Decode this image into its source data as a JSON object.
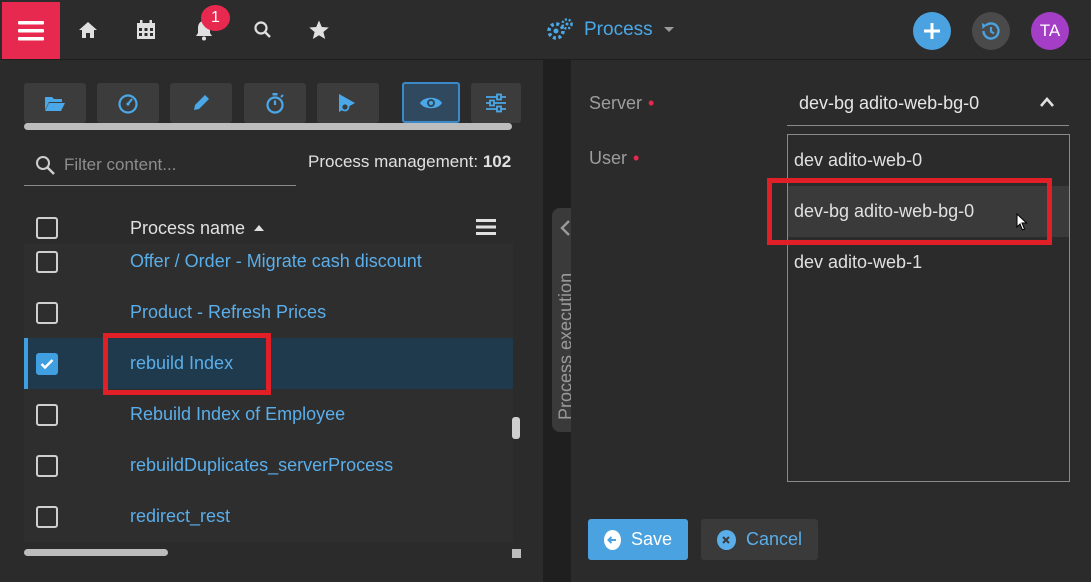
{
  "topbar": {
    "notification_count": "1",
    "module_title": "Process",
    "avatar_initials": "TA",
    "icons": [
      "menu-icon",
      "home-icon",
      "calendar-icon",
      "bell-icon",
      "search-icon",
      "star-icon",
      "gears-icon",
      "plus-icon",
      "history-icon"
    ]
  },
  "left": {
    "toolbar_icons": [
      "folder-open-icon",
      "speedometer-icon",
      "pencil-icon",
      "stopwatch-icon",
      "play-gear-icon",
      "eye-icon",
      "sliders-icon"
    ],
    "filter_placeholder": "Filter content...",
    "count_label": "Process management:",
    "count_value": "102",
    "column_header": "Process name",
    "rows": [
      {
        "name": "Offer / Order - Migrate cash discount",
        "checked": false
      },
      {
        "name": "Product - Refresh Prices",
        "checked": false
      },
      {
        "name": "rebuild Index",
        "checked": true
      },
      {
        "name": "Rebuild Index of Employee",
        "checked": false
      },
      {
        "name": "rebuildDuplicates_serverProcess",
        "checked": false
      },
      {
        "name": "redirect_rest",
        "checked": false
      }
    ]
  },
  "splitter": {
    "label": "Process execution"
  },
  "right": {
    "server_label": "Server",
    "server_value": "dev-bg adito-web-bg-0",
    "user_label": "User",
    "required_mark": "•",
    "options": [
      "dev adito-web-0",
      "dev-bg adito-web-bg-0",
      "dev adito-web-1"
    ],
    "hovered_option": "dev-bg adito-web-bg-0",
    "save_label": "Save",
    "cancel_label": "Cancel"
  },
  "colors": {
    "accent_red": "#e8294f",
    "accent_blue": "#4aa3e0",
    "link_blue": "#5aaeea",
    "avatar_purple": "#a43ec7",
    "highlight_box_red": "#e01f26",
    "background": "#2b2b2b"
  }
}
